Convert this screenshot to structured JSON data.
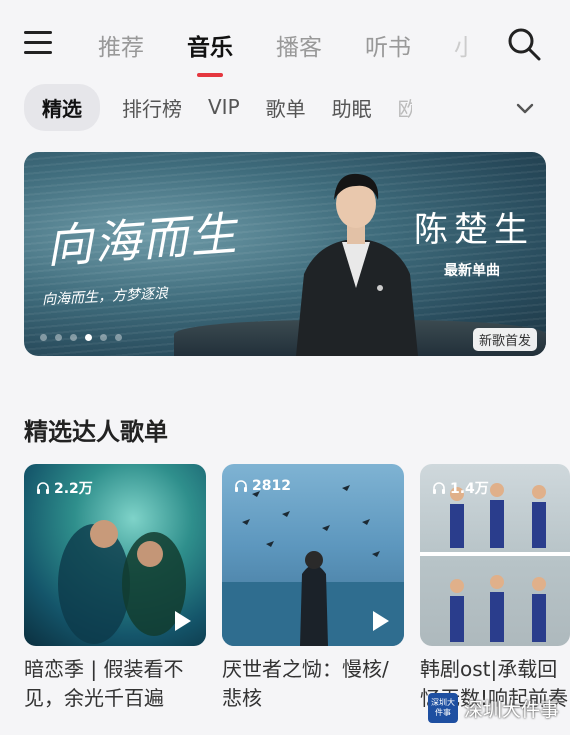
{
  "top_tabs": [
    "推荐",
    "音乐",
    "播客",
    "听书",
    "小"
  ],
  "active_top_tab": "音乐",
  "sub_tabs": [
    "精选",
    "排行榜",
    "VIP",
    "歌单",
    "助眠",
    "欧"
  ],
  "banner": {
    "title_script": "向海而生",
    "subtitle_script": "向海而生，方梦逐浪",
    "artist": "陈楚生",
    "label": "最新单曲",
    "badge": "新歌首发",
    "dots_total": 6,
    "dots_active_index": 3
  },
  "section": {
    "title": "精选达人歌单"
  },
  "playlists": [
    {
      "plays": "2.2万",
      "title": "暗恋季 | 假装看不见，余光千百遍"
    },
    {
      "plays": "2812",
      "title": "厌世者之恸：慢核/悲核"
    },
    {
      "plays": "1.4万",
      "title": "韩剧ost|承载回忆无数!响起前奏"
    }
  ],
  "watermark": {
    "text": "深圳大件事",
    "logo_text": "深圳大件事"
  },
  "colors": {
    "accent": "#e5373f",
    "background": "#f5f5f7"
  }
}
